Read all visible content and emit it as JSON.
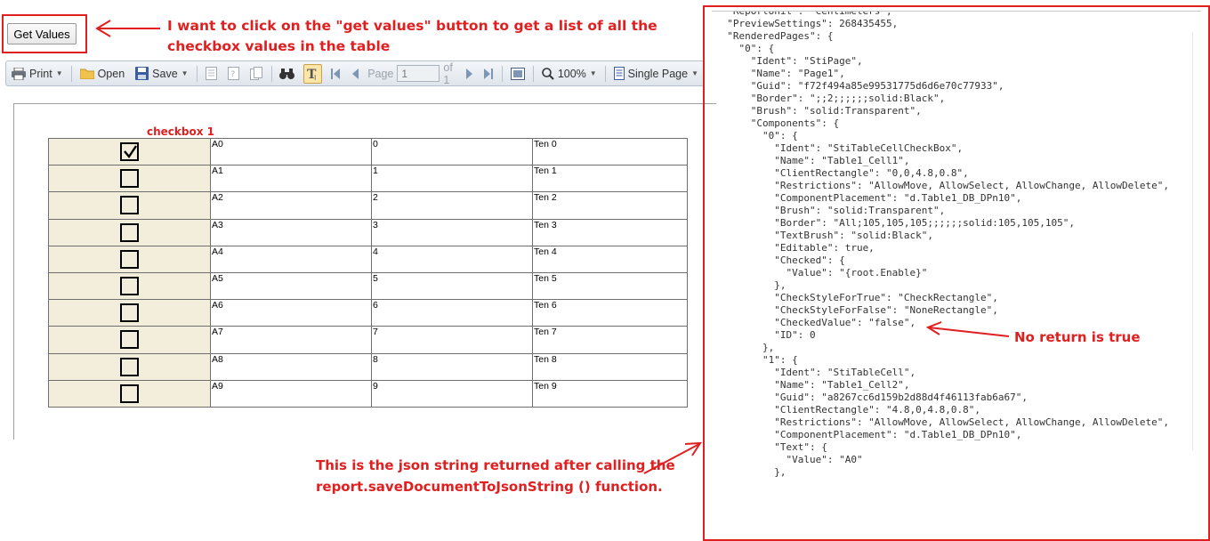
{
  "get_values_button": {
    "label": "Get Values"
  },
  "annotations": {
    "button_note_line1": "I want to click on the \"get values\" button to get a list of all the",
    "button_note_line2": "checkbox values in the table",
    "checkbox_note": "checkbox 1",
    "json_note_line1": "This is the json string returned after calling the",
    "json_note_line2": "report.saveDocumentToJsonString () function.",
    "return_note": "No return is true"
  },
  "toolbar": {
    "print": "Print",
    "open": "Open",
    "save": "Save",
    "page_label": "Page",
    "page_value": "1",
    "of_pages": "of 1",
    "zoom": "100%",
    "view_mode": "Single Page"
  },
  "table": {
    "rows": [
      {
        "checked": true,
        "col1": "A0",
        "col2": "0",
        "col3": "Ten 0"
      },
      {
        "checked": false,
        "col1": "A1",
        "col2": "1",
        "col3": "Ten 1"
      },
      {
        "checked": false,
        "col1": "A2",
        "col2": "2",
        "col3": "Ten 2"
      },
      {
        "checked": false,
        "col1": "A3",
        "col2": "3",
        "col3": "Ten 3"
      },
      {
        "checked": false,
        "col1": "A4",
        "col2": "4",
        "col3": "Ten 4"
      },
      {
        "checked": false,
        "col1": "A5",
        "col2": "5",
        "col3": "Ten 5"
      },
      {
        "checked": false,
        "col1": "A6",
        "col2": "6",
        "col3": "Ten 6"
      },
      {
        "checked": false,
        "col1": "A7",
        "col2": "7",
        "col3": "Ten 7"
      },
      {
        "checked": false,
        "col1": "A8",
        "col2": "8",
        "col3": "Ten 8"
      },
      {
        "checked": false,
        "col1": "A9",
        "col2": "9",
        "col3": "Ten 9"
      }
    ]
  },
  "json_lines": [
    "  \"ReportUnit\": \"Centimeters\",",
    "  \"PreviewSettings\": 268435455,",
    "  \"RenderedPages\": {",
    "    \"0\": {",
    "      \"Ident\": \"StiPage\",",
    "      \"Name\": \"Page1\",",
    "      \"Guid\": \"f72f494a85e99531775d6d6e70c77933\",",
    "      \"Border\": \";;2;;;;;;solid:Black\",",
    "      \"Brush\": \"solid:Transparent\",",
    "      \"Components\": {",
    "        \"0\": {",
    "          \"Ident\": \"StiTableCellCheckBox\",",
    "          \"Name\": \"Table1_Cell1\",",
    "          \"ClientRectangle\": \"0,0,4.8,0.8\",",
    "          \"Restrictions\": \"AllowMove, AllowSelect, AllowChange, AllowDelete\",",
    "          \"ComponentPlacement\": \"d.Table1_DB_DPn10\",",
    "          \"Brush\": \"solid:Transparent\",",
    "          \"Border\": \"All;105,105,105;;;;;;solid:105,105,105\",",
    "          \"TextBrush\": \"solid:Black\",",
    "          \"Editable\": true,",
    "          \"Checked\": {",
    "            \"Value\": \"{root.Enable}\"",
    "          },",
    "          \"CheckStyleForTrue\": \"CheckRectangle\",",
    "          \"CheckStyleForFalse\": \"NoneRectangle\",",
    "          \"CheckedValue\": \"false\",",
    "          \"ID\": 0",
    "        },",
    "        \"1\": {",
    "          \"Ident\": \"StiTableCell\",",
    "          \"Name\": \"Table1_Cell2\",",
    "          \"Guid\": \"a8267cc6d159b2d88d4f46113fab6a67\",",
    "          \"ClientRectangle\": \"4.8,0,4.8,0.8\",",
    "          \"Restrictions\": \"AllowMove, AllowSelect, AllowChange, AllowDelete\",",
    "          \"ComponentPlacement\": \"d.Table1_DB_DPn10\",",
    "          \"Text\": {",
    "            \"Value\": \"A0\"",
    "          },"
  ],
  "colors": {
    "annotation_red": "#e02020",
    "checkbox_cell_bg": "#f3eedb",
    "toolbar_bg": "#e8edf2"
  }
}
